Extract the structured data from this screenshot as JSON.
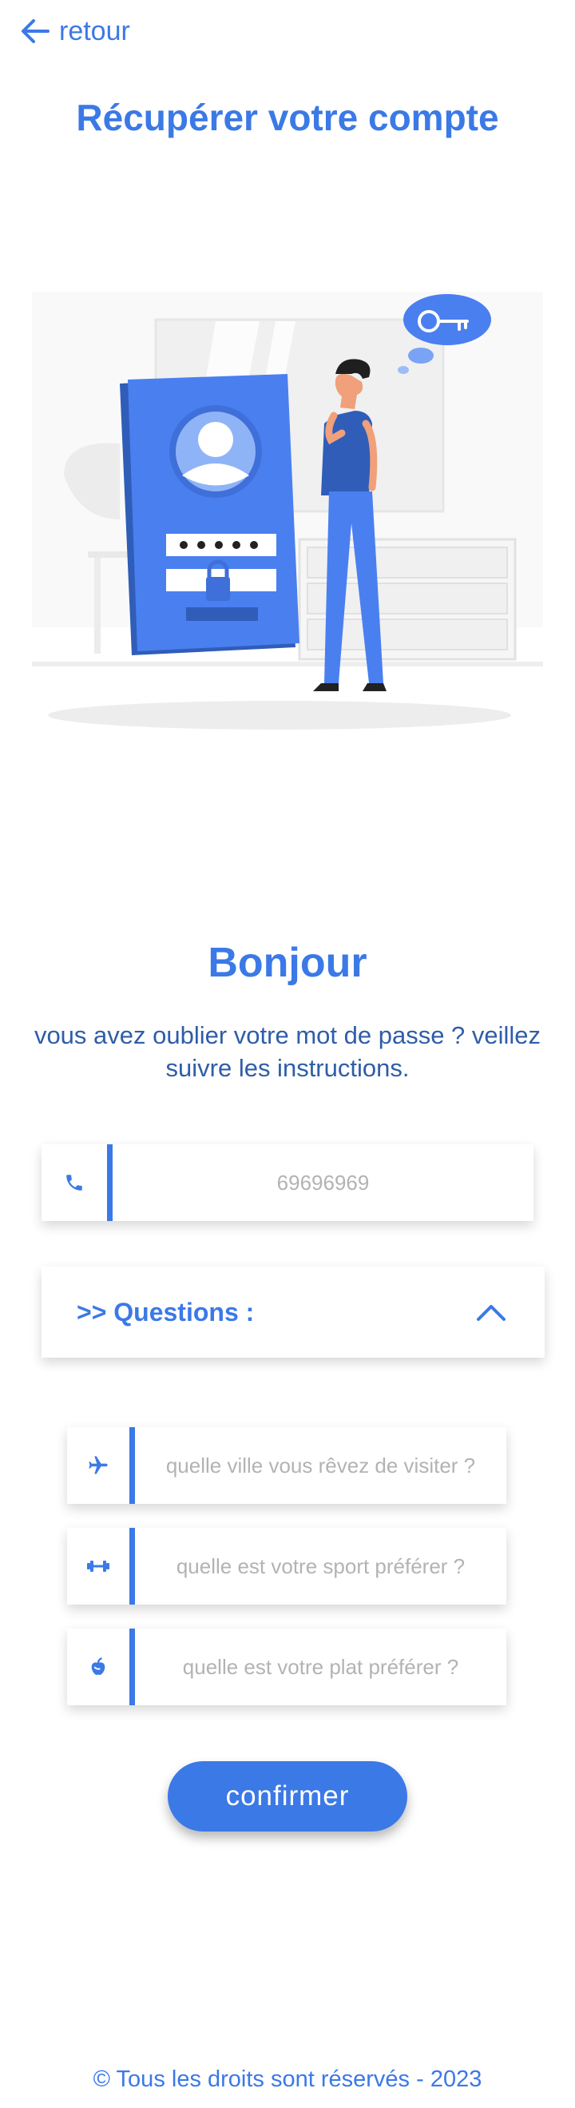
{
  "header": {
    "back_label": "retour",
    "title": "Récupérer votre compte"
  },
  "intro": {
    "greeting": "Bonjour",
    "message": "vous avez oublier votre mot de passe ? veillez suivre les instructions."
  },
  "phone_field": {
    "placeholder": "69696969",
    "icon": "phone-icon"
  },
  "questions": {
    "header_label": ">> Questions :",
    "expanded": true,
    "items": [
      {
        "icon": "airplane-icon",
        "placeholder": "quelle ville vous rêvez de visiter ?"
      },
      {
        "icon": "dumbbell-icon",
        "placeholder": "quelle est votre sport préférer ?"
      },
      {
        "icon": "fruit-icon",
        "placeholder": "quelle est votre plat préférer ?"
      }
    ]
  },
  "actions": {
    "confirm_label": "confirmer"
  },
  "footer": {
    "text": "© Tous les droits sont réservés - 2023"
  },
  "colors": {
    "accent": "#3b79e6",
    "text_blue": "#2f5da8",
    "placeholder": "#b3b3b3"
  }
}
